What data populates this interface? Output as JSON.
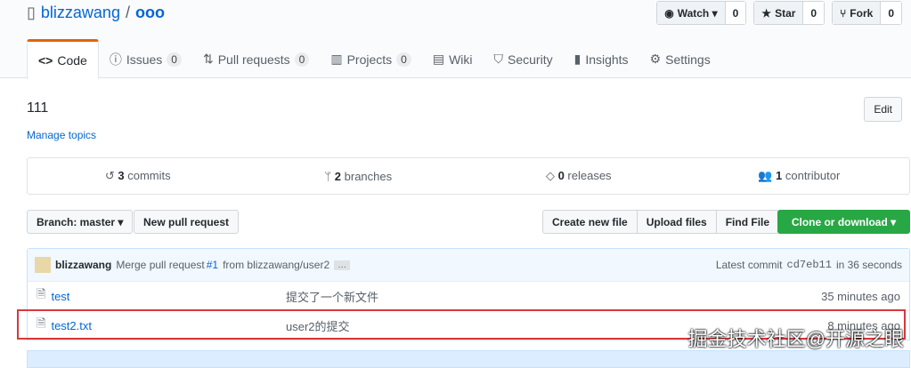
{
  "repo": {
    "owner": "blizzawang",
    "name": "ooo"
  },
  "actions": [
    {
      "label": "Watch ▾",
      "count": "0",
      "icon": "eye-icon"
    },
    {
      "label": "Star",
      "count": "0",
      "icon": "star-icon"
    },
    {
      "label": "Fork",
      "count": "0",
      "icon": "fork-icon"
    }
  ],
  "tabs": [
    {
      "label": "Code",
      "icon": "<>"
    },
    {
      "label": "Issues",
      "count": "0",
      "icon": "ⓘ"
    },
    {
      "label": "Pull requests",
      "count": "0",
      "icon": "⇅"
    },
    {
      "label": "Projects",
      "count": "0",
      "icon": "▥"
    },
    {
      "label": "Wiki",
      "icon": "▤"
    },
    {
      "label": "Security",
      "icon": "⛉"
    },
    {
      "label": "Insights",
      "icon": "▮"
    },
    {
      "label": "Settings",
      "icon": "⚙"
    }
  ],
  "description": "111",
  "manage_topics": "Manage topics",
  "edit": "Edit",
  "summary": [
    {
      "n": "3",
      "l": " commits"
    },
    {
      "n": "2",
      "l": " branches"
    },
    {
      "n": "0",
      "l": " releases"
    },
    {
      "n": "1",
      "l": " contributor"
    }
  ],
  "branch": "Branch: master ▾",
  "new_pr": "New pull request",
  "file_buttons": [
    "Create new file",
    "Upload files",
    "Find File"
  ],
  "clone": "Clone or download ▾",
  "commit": {
    "author": "blizzawang",
    "msg": "Merge pull request",
    "pr": "#1",
    "from": "from blizzawang/user2",
    "ellipsis": "…",
    "latest": "Latest commit",
    "sha": "cd7eb11",
    "age": "in 36 seconds"
  },
  "files": [
    {
      "name": "test",
      "message": "提交了一个新文件",
      "age": "35 minutes ago"
    },
    {
      "name": "test2.txt",
      "message": "user2的提交",
      "age": "8 minutes ago"
    }
  ],
  "watermark": "掘金技术社区@开源之眼"
}
